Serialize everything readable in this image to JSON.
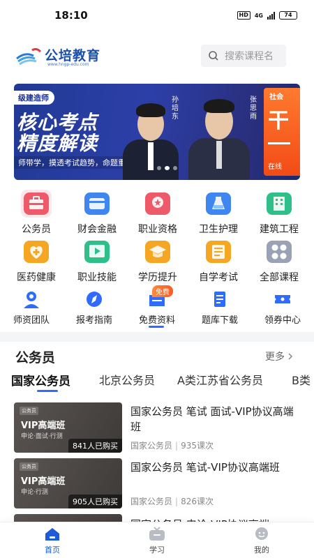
{
  "status_bar": {
    "time": "18:10",
    "hd": "HD",
    "network": "4G",
    "battery": "74"
  },
  "header": {
    "logo_text": "公培教育",
    "logo_url": "www.hngp-edu.com",
    "search_placeholder": "搜索课程名"
  },
  "banner": {
    "tag": "级建造师",
    "headline_1": "核心考点",
    "headline_2": "精度解读",
    "subtitle": "师带学，摸透考试趋势，命题重点把握准",
    "person_1": "孙培东",
    "person_2": "张思雨",
    "right_top": "社会",
    "right_big": "干",
    "right_bottom": "在线"
  },
  "categories": [
    {
      "label": "公务员",
      "icon": "briefcase-icon",
      "color": "#ef5a6b"
    },
    {
      "label": "财会金融",
      "icon": "card-icon",
      "color": "#3f86f0"
    },
    {
      "label": "职业资格",
      "icon": "badge-star-icon",
      "color": "#ef5a6b"
    },
    {
      "label": "卫生护理",
      "icon": "flask-icon",
      "color": "#3f86f0"
    },
    {
      "label": "建筑工程",
      "icon": "building-icon",
      "color": "#2fc08a"
    },
    {
      "label": "医药健康",
      "icon": "heart-plus-icon",
      "color": "#f5a623"
    },
    {
      "label": "职业技能",
      "icon": "play-board-icon",
      "color": "#2fc08a"
    },
    {
      "label": "学历提升",
      "icon": "grad-cap-icon",
      "color": "#f5a623"
    },
    {
      "label": "自学考试",
      "icon": "document-icon",
      "color": "#f5a623"
    },
    {
      "label": "全部课程",
      "icon": "grid-four-icon",
      "color": "#9aa3b5"
    }
  ],
  "quick_links": [
    {
      "label": "师资团队",
      "icon": "teacher-icon"
    },
    {
      "label": "报考指南",
      "icon": "compass-icon"
    },
    {
      "label": "免费资料",
      "icon": "folder-icon"
    },
    {
      "label": "题库下载",
      "icon": "question-bank-icon"
    },
    {
      "label": "领券中心",
      "icon": "coupon-icon"
    }
  ],
  "free_badge": "免费",
  "section": {
    "title": "公务员",
    "more": "更多",
    "tabs": [
      "国家公务员",
      "北京公务员",
      "A类江苏省公务员",
      "B类"
    ]
  },
  "courses": [
    {
      "thumb_tag": "公务员",
      "thumb_title": "VIP高端班",
      "thumb_sub": "申论·面试·行测",
      "buyers": "841人已购买",
      "title": "国家公务员 笔试 面试-VIP协议高端班",
      "category": "国家公务员",
      "lessons": "935课次"
    },
    {
      "thumb_tag": "公务员",
      "thumb_title": "VIP高端班",
      "thumb_sub": "申论·行测",
      "buyers": "905人已购买",
      "title": "国家公务员 笔试-VIP协议高端班",
      "category": "国家公务员",
      "lessons": "826课次"
    },
    {
      "thumb_tag": "",
      "thumb_title": "",
      "thumb_sub": "",
      "buyers": "",
      "title": "国家公务员 申论-VIP协议高端",
      "category": "",
      "lessons": ""
    }
  ],
  "bottom_nav": [
    {
      "label": "首页",
      "icon": "home-icon",
      "active": true
    },
    {
      "label": "学习",
      "icon": "tv-icon",
      "active": false
    },
    {
      "label": "我的",
      "icon": "profile-icon",
      "active": false
    }
  ],
  "colors": {
    "accent": "#2f6bff",
    "brand": "#1b4fa8",
    "banner": "#2c3fa8"
  }
}
